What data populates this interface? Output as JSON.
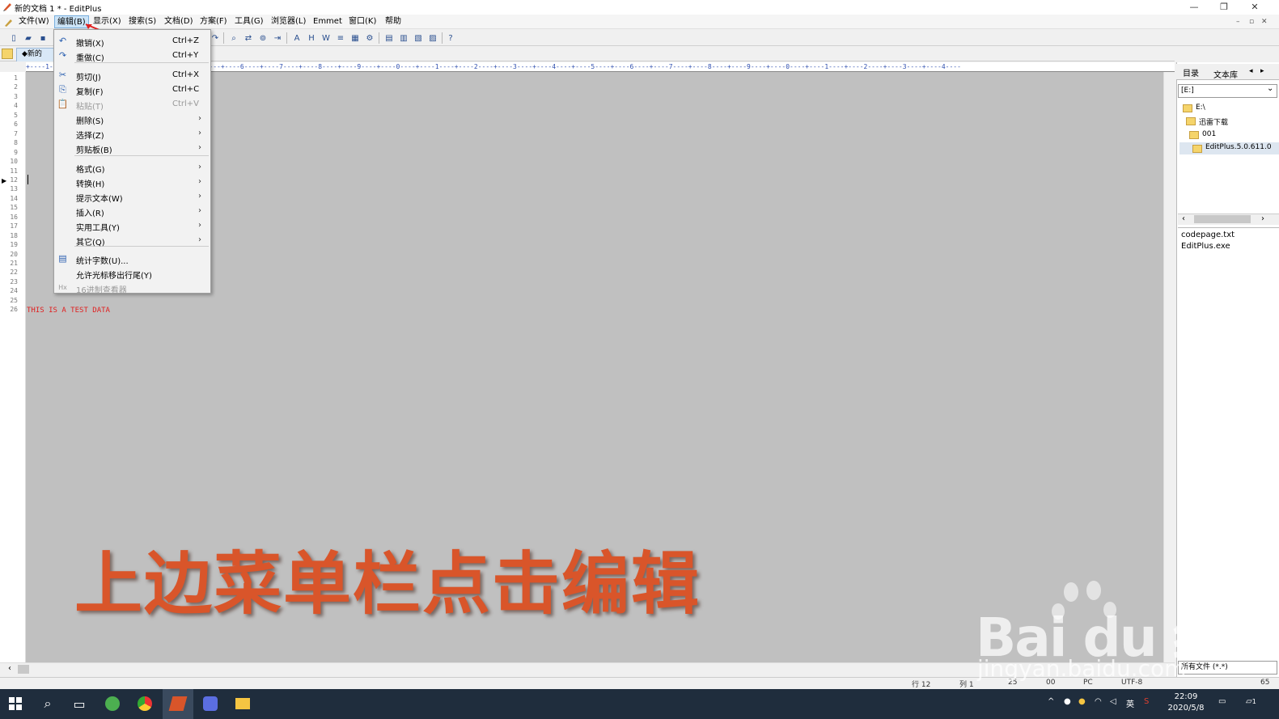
{
  "window": {
    "title": "新的文档 1 * - EditPlus",
    "minimize": "—",
    "restore": "❐",
    "close": "✕"
  },
  "menubar": {
    "items": [
      "文件(W)",
      "编辑(B)",
      "显示(X)",
      "搜索(S)",
      "文档(D)",
      "方案(F)",
      "工具(G)",
      "浏览器(L)",
      "Emmet",
      "窗口(K)",
      "帮助"
    ],
    "mdi_min": "–",
    "mdi_restore": "▫",
    "mdi_close": "✕"
  },
  "tab": {
    "label": "◆新的"
  },
  "ruler": "+----1----+----2----+----3----+----4----+----5----+----6----+----7----+----8----+----9----+----0----+----1----+----2----+----3----+----4----+----5----+----6----+----7----+----8----+----9----+----0----+----1----+----2----+----3----+----4----",
  "editor": {
    "line_numbers": [
      "1",
      "2",
      "3",
      "4",
      "5",
      "6",
      "7",
      "8",
      "9",
      "10",
      "11",
      "12",
      "13",
      "14",
      "15",
      "16",
      "17",
      "18",
      "19",
      "20",
      "21",
      "22",
      "23",
      "24",
      "25",
      "26"
    ],
    "text": "THIS IS A TEST DATA",
    "marker": "▶"
  },
  "edit_menu": {
    "items": [
      {
        "label": "撤销(X)",
        "shortcut": "Ctrl+Z",
        "icon": "undo-icon",
        "glyph": "↶"
      },
      {
        "label": "重做(C)",
        "shortcut": "Ctrl+Y",
        "icon": "redo-icon",
        "glyph": "↷"
      },
      {
        "label": "剪切(J)",
        "shortcut": "Ctrl+X",
        "icon": "cut-icon",
        "glyph": "✂"
      },
      {
        "label": "复制(F)",
        "shortcut": "Ctrl+C",
        "icon": "copy-icon",
        "glyph": "⎘"
      },
      {
        "label": "粘贴(T)",
        "shortcut": "Ctrl+V",
        "icon": "paste-icon",
        "glyph": "📋",
        "disabled": true
      },
      {
        "label": "删除(S)",
        "submenu": true
      },
      {
        "label": "选择(Z)",
        "submenu": true
      },
      {
        "label": "剪贴板(B)",
        "submenu": true
      },
      {
        "label": "格式(G)",
        "submenu": true
      },
      {
        "label": "转换(H)",
        "submenu": true
      },
      {
        "label": "提示文本(W)",
        "submenu": true
      },
      {
        "label": "插入(R)",
        "submenu": true
      },
      {
        "label": "实用工具(Y)",
        "submenu": true
      },
      {
        "label": "其它(Q)",
        "submenu": true
      },
      {
        "label": "统计字数(U)...",
        "icon": "stats-icon",
        "glyph": "▤"
      },
      {
        "label": "允许光标移出行尾(Y)"
      },
      {
        "label": "16进制查看器",
        "icon": "hex-icon",
        "glyph": "Hx",
        "disabled": true
      }
    ],
    "arrow": "›"
  },
  "right_panel": {
    "tabs": [
      "目录",
      "文本库"
    ],
    "tab_prev": "◂",
    "tab_next": "▸",
    "drive": "[E:]",
    "dropdown_arrow": "⌄",
    "tree": [
      "E:\\",
      "迅雷下载",
      "001",
      "EditPlus.5.0.611.0"
    ],
    "files": [
      "codepage.txt",
      "EditPlus.exe"
    ],
    "filter": "所有文件 (*.*)",
    "scroll_left": "‹",
    "scroll_right": "›"
  },
  "status": {
    "row": "行 12",
    "col": "列 1",
    "num1": "25",
    "num2": "00",
    "mode": "PC",
    "encoding": "UTF-8",
    "extra": "65"
  },
  "overlay_caption": "上边菜单栏点击编辑",
  "watermark": {
    "main": "Bai du 经验",
    "url": "jingyan.baidu.com"
  },
  "taskbar": {
    "time": "22:09",
    "date": "2020/5/8",
    "ime": "英",
    "notification_count": "1"
  }
}
